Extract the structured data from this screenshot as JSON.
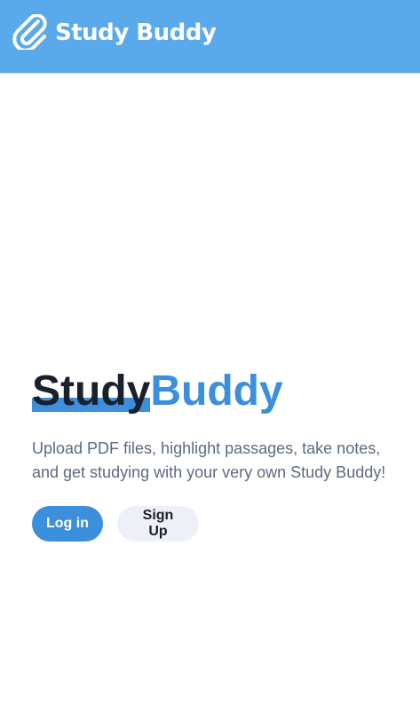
{
  "header": {
    "brand": "Study Buddy",
    "logo_icon": "paperclip-icon",
    "background": "#5aaaeb"
  },
  "hero": {
    "title_part1": "Study",
    "title_part2": "Buddy",
    "description": "Upload PDF files, highlight passages, take notes, and get studying with your very own Study Buddy!",
    "accent": "#3b8fdc"
  },
  "actions": {
    "login_label": "Log in",
    "signup_label": "Sign Up"
  }
}
